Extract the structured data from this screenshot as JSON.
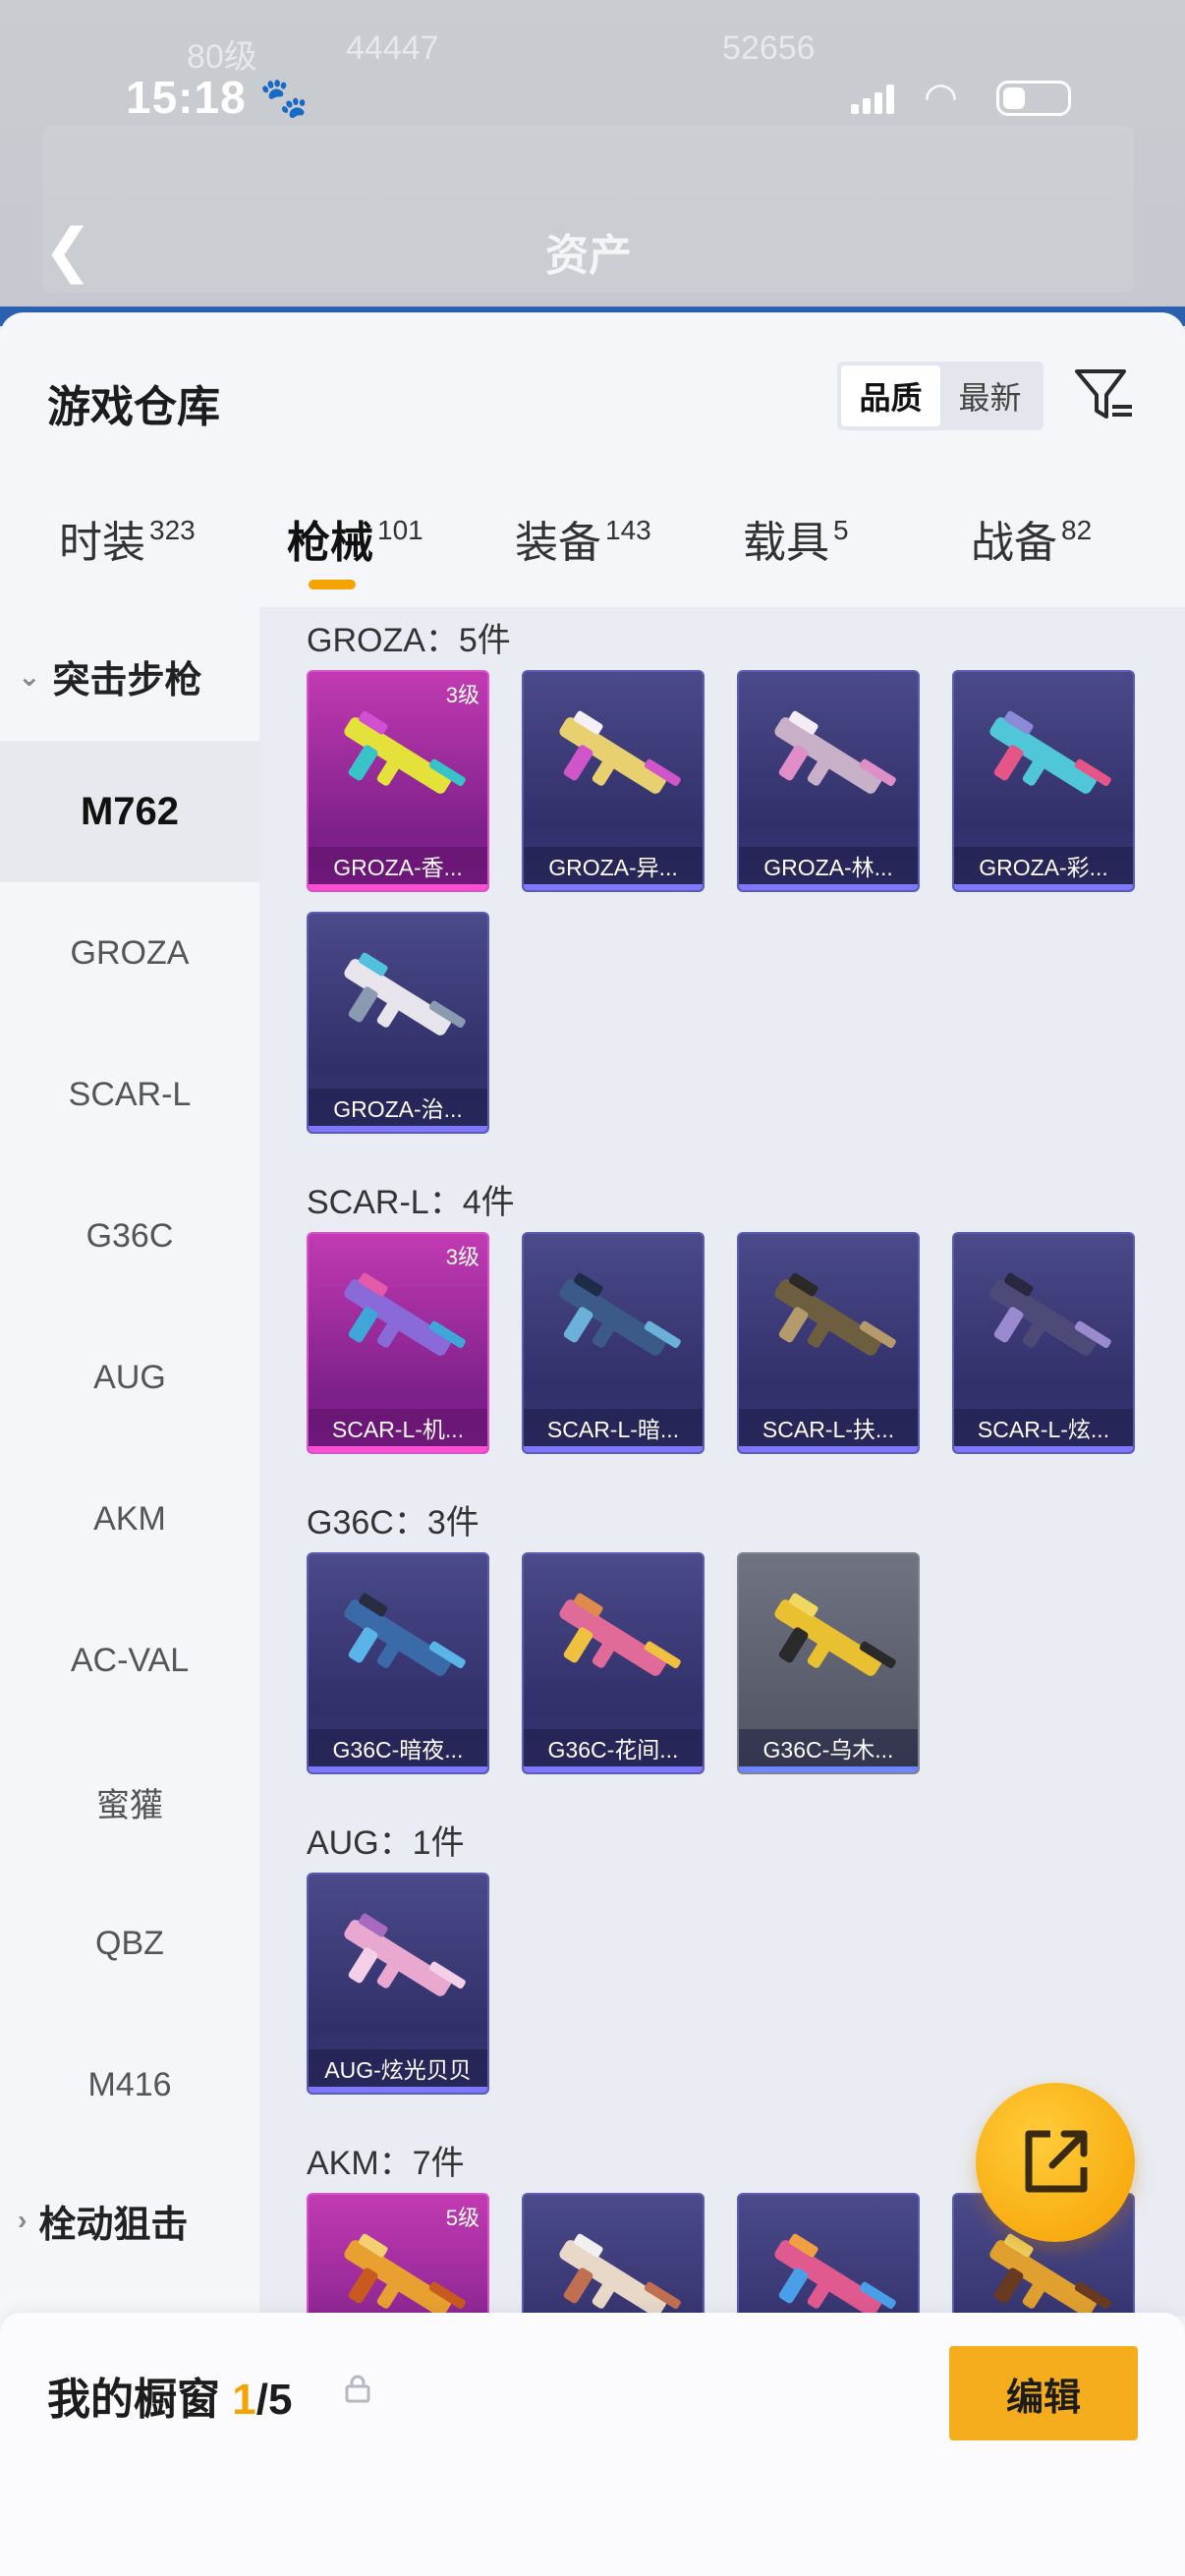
{
  "status_bar": {
    "time": "15:18"
  },
  "background": {
    "ghost_level": "80级",
    "ghost_num1": "44447",
    "ghost_num2": "52656",
    "asset_title": "资产"
  },
  "sheet": {
    "title": "游戏仓库",
    "sort": {
      "quality": "品质",
      "latest": "最新"
    }
  },
  "tabs": [
    {
      "label": "时装",
      "count": "323"
    },
    {
      "label": "枪械",
      "count": "101"
    },
    {
      "label": "装备",
      "count": "143"
    },
    {
      "label": "载具",
      "count": "5"
    },
    {
      "label": "战备",
      "count": "82"
    }
  ],
  "sidebar": {
    "category_open": "突击步枪",
    "items": [
      "M762",
      "GROZA",
      "SCAR-L",
      "G36C",
      "AUG",
      "AKM",
      "AC-VAL",
      "蜜獾",
      "QBZ",
      "M416"
    ],
    "category_closed": "栓动狙击"
  },
  "sections": [
    {
      "header": "GROZA：5件",
      "cards": [
        {
          "name": "GROZA-香...",
          "level": "3级",
          "rarity": "gold"
        },
        {
          "name": "GROZA-异...",
          "level": "",
          "rarity": "purple"
        },
        {
          "name": "GROZA-林...",
          "level": "",
          "rarity": "purple"
        },
        {
          "name": "GROZA-彩...",
          "level": "",
          "rarity": "purple"
        },
        {
          "name": "GROZA-治...",
          "level": "",
          "rarity": "purple"
        }
      ]
    },
    {
      "header": "SCAR-L：4件",
      "cards": [
        {
          "name": "SCAR-L-机...",
          "level": "3级",
          "rarity": "gold"
        },
        {
          "name": "SCAR-L-暗...",
          "level": "",
          "rarity": "purple"
        },
        {
          "name": "SCAR-L-扶...",
          "level": "",
          "rarity": "purple"
        },
        {
          "name": "SCAR-L-炫...",
          "level": "",
          "rarity": "purple"
        }
      ]
    },
    {
      "header": "G36C：3件",
      "cards": [
        {
          "name": "G36C-暗夜...",
          "level": "",
          "rarity": "purple"
        },
        {
          "name": "G36C-花间...",
          "level": "",
          "rarity": "purple"
        },
        {
          "name": "G36C-乌木...",
          "level": "",
          "rarity": "grey"
        }
      ]
    },
    {
      "header": "AUG：1件",
      "cards": [
        {
          "name": "AUG-炫光贝贝",
          "level": "",
          "rarity": "purple"
        }
      ]
    },
    {
      "header": "AKM：7件",
      "cards": [
        {
          "name": "",
          "level": "5级",
          "rarity": "gold"
        },
        {
          "name": "",
          "level": "",
          "rarity": "purple"
        },
        {
          "name": "",
          "level": "",
          "rarity": "purple"
        },
        {
          "name": "",
          "level": "",
          "rarity": "purple"
        }
      ]
    }
  ],
  "bottom": {
    "label": "我的橱窗",
    "current": "1",
    "total": "/5",
    "edit": "编辑"
  },
  "colors": {
    "accent": "#f5a300",
    "gold_card": "#c23ab2",
    "purple_card": "#3a3875",
    "grey_card": "#707381"
  },
  "icons": {
    "back": "back-arrow-icon",
    "filter": "filter-icon",
    "share": "share-external-icon",
    "lock": "lock-icon"
  }
}
